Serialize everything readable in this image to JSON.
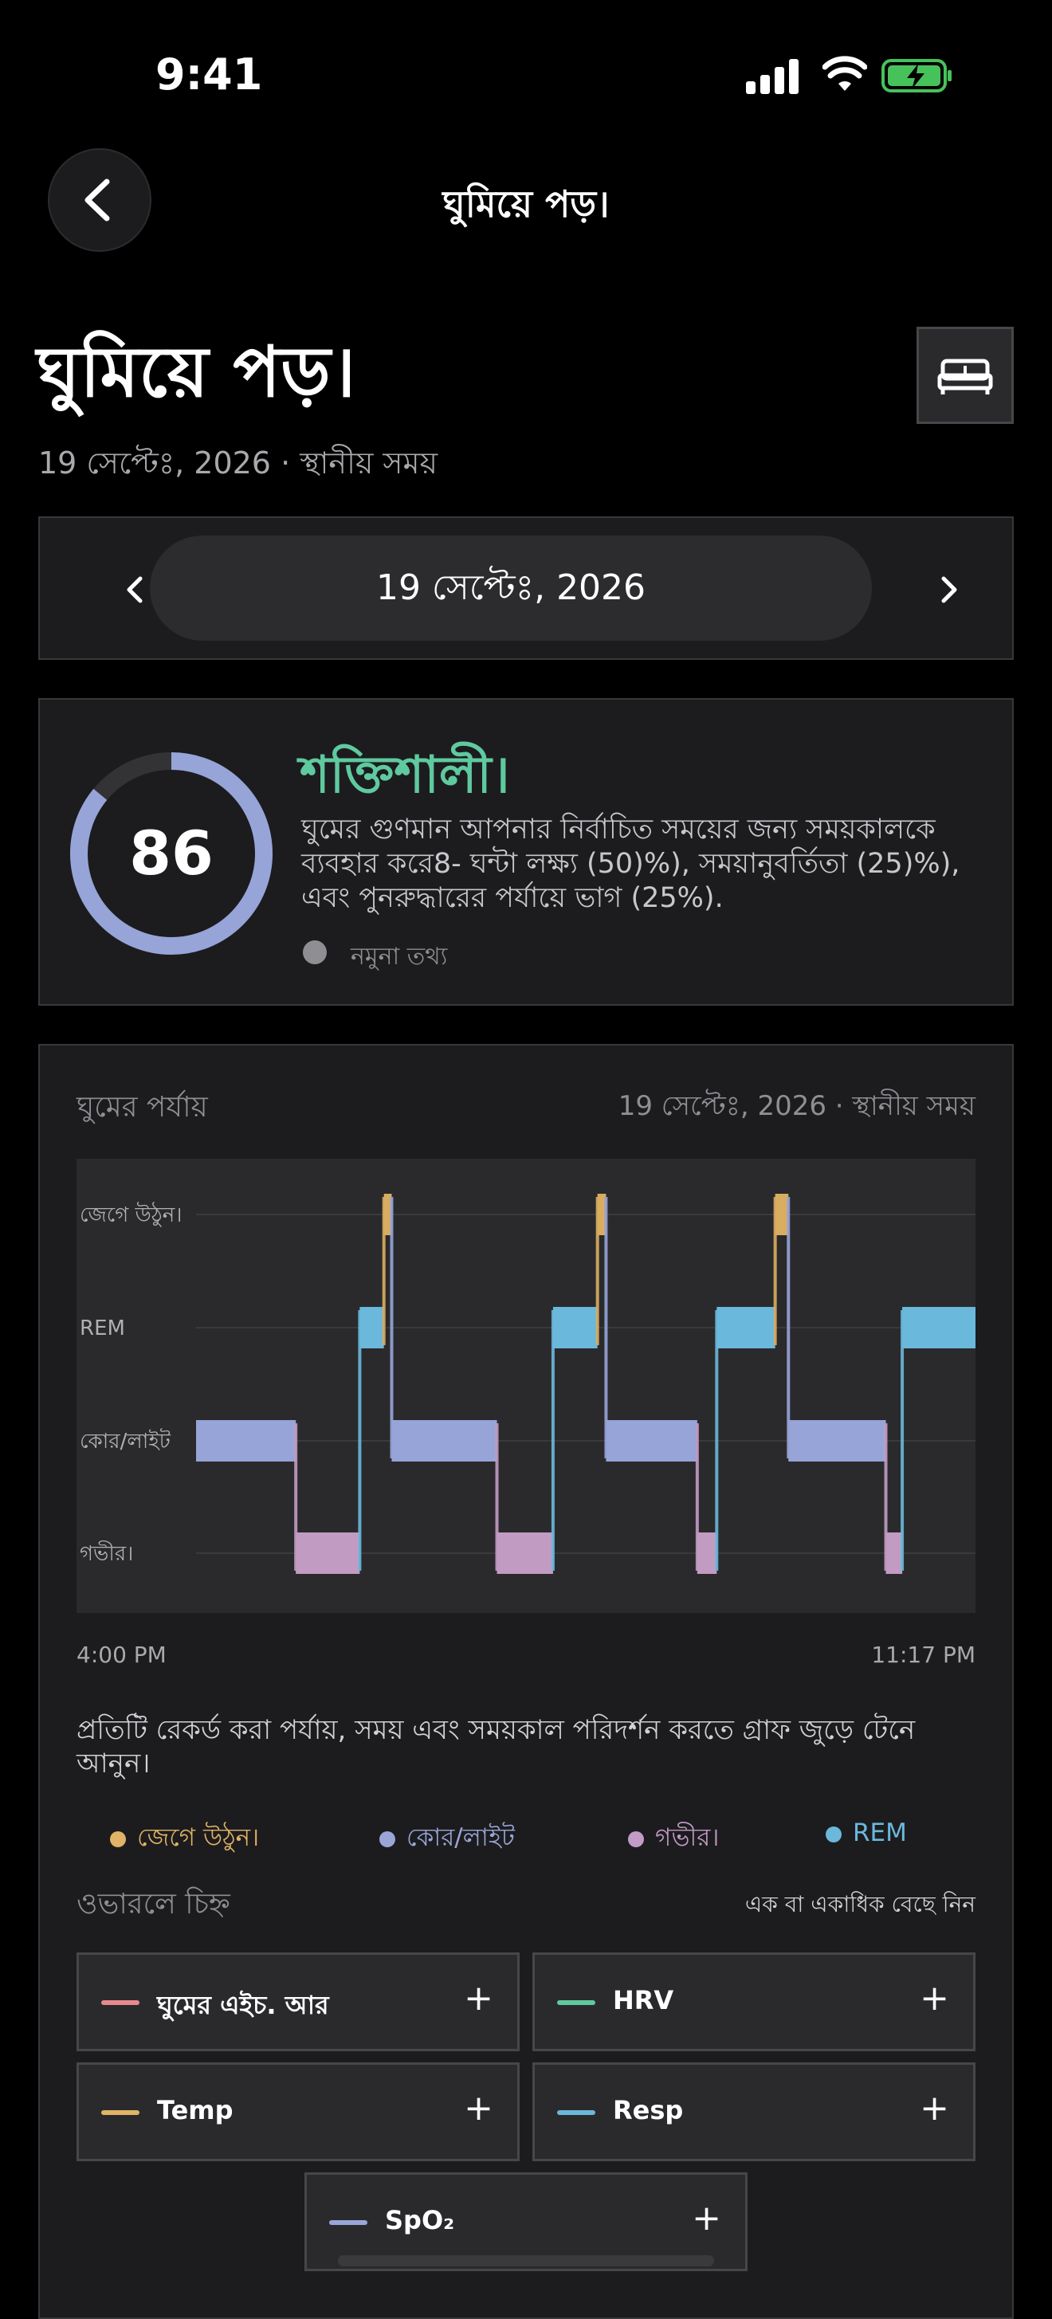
{
  "status_bar": {
    "time": "9:41"
  },
  "nav": {
    "title": "ঘুমিয়ে পড়।",
    "back_icon": "chevron-left-icon"
  },
  "header": {
    "title": "ঘুমিয়ে পড়।",
    "subtitle": "19 সেপ্টেঃ, 2026 · স্থানীয় সময়",
    "bed_icon": "bed-icon"
  },
  "date_selector": {
    "date": "19 সেপ্টেঃ, 2026"
  },
  "score": {
    "value": "86",
    "label": "শক্তিশালী।",
    "description": "ঘুমের গুণমান আপনার নির্বাচিত সময়ের জন্য সময়কালকে ব্যবহার করে8- ঘন্টা লক্ষ্য (50)%), সময়ানুবর্তিতা (25)%), এবং পুনরুদ্ধারের পর্যায়ে ভাগ (25%).",
    "sample_text": "নমুনা তথ্য",
    "ring_fraction": 0.86
  },
  "stages": {
    "title": "ঘুমের পর্যায়",
    "date": "19 সেপ্টেঃ, 2026 · স্থানীয় সময়",
    "time_start": "4:00 PM",
    "time_end": "11:17 PM",
    "hint": "প্রতিটি রেকর্ড করা পর্যায়, সময় এবং সময়কাল পরিদর্শন করতে গ্রাফ জুড়ে টেনে আনুন।",
    "legend": [
      {
        "label": "জেগে উঠুন।",
        "color": "#e0b366"
      },
      {
        "label": "কোর/লাইট",
        "color": "#9aa6d8"
      },
      {
        "label": "গভীর।",
        "color": "#c39bc7"
      },
      {
        "label": "REM",
        "color": "#6bb8db"
      }
    ]
  },
  "chart_data": {
    "type": "hypnogram",
    "x_range": [
      "4:00 PM",
      "11:17 PM"
    ],
    "y_categories": [
      "জেগে উঠুন।",
      "REM",
      "কোর/লাইট",
      "গভীর।"
    ],
    "segments": [
      {
        "stage": "কোর/লাইট",
        "start": 0.0,
        "end": 0.128
      },
      {
        "stage": "গভীর।",
        "start": 0.128,
        "end": 0.21
      },
      {
        "stage": "REM",
        "start": 0.21,
        "end": 0.241
      },
      {
        "stage": "জেগে উঠুন।",
        "start": 0.241,
        "end": 0.251
      },
      {
        "stage": "কোর/লাইট",
        "start": 0.251,
        "end": 0.386
      },
      {
        "stage": "গভীর।",
        "start": 0.386,
        "end": 0.458
      },
      {
        "stage": "REM",
        "start": 0.458,
        "end": 0.515
      },
      {
        "stage": "জেগে উঠুন।",
        "start": 0.515,
        "end": 0.526
      },
      {
        "stage": "কোর/লাইট",
        "start": 0.526,
        "end": 0.643
      },
      {
        "stage": "গভীর।",
        "start": 0.643,
        "end": 0.668
      },
      {
        "stage": "REM",
        "start": 0.668,
        "end": 0.743
      },
      {
        "stage": "জেগে উঠুন।",
        "start": 0.743,
        "end": 0.76
      },
      {
        "stage": "কোর/লাইট",
        "start": 0.76,
        "end": 0.885
      },
      {
        "stage": "গভীর।",
        "start": 0.885,
        "end": 0.906
      },
      {
        "stage": "REM",
        "start": 0.906,
        "end": 1.0
      }
    ],
    "colors": {
      "জেগে উঠুন।": "#d9ad60",
      "REM": "#6ab8db",
      "কোর/লাইট": "#97a4d8",
      "গভীর।": "#c29bc3"
    }
  },
  "overlay": {
    "title": "ওভারলে চিহ্ন",
    "hint": "এক বা একাধিক বেছে নিন",
    "metrics": [
      {
        "name": "ঘুমের এইচ. আর",
        "color": "#e8898f"
      },
      {
        "name": "HRV",
        "color": "#5fc99f"
      },
      {
        "name": "Temp",
        "color": "#e0b366"
      },
      {
        "name": "Resp",
        "color": "#6bb8db"
      },
      {
        "name": "SpO₂",
        "color": "#9aa6d8"
      }
    ],
    "plus_label": "+"
  }
}
